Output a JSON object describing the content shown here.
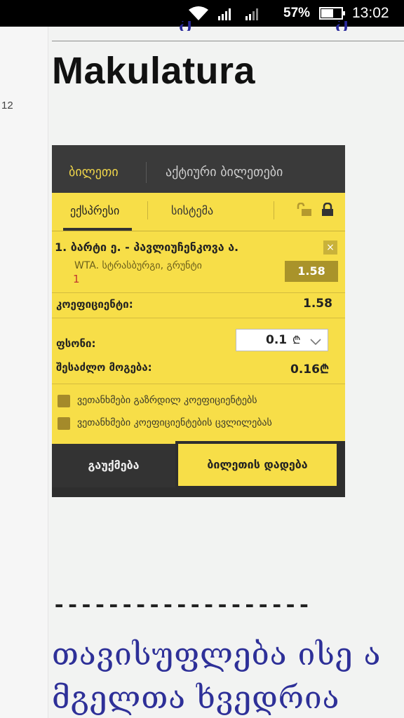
{
  "status_bar": {
    "battery_percent": "57%",
    "time": "13:02",
    "icons": [
      "wifi-icon",
      "cell-signal-icon",
      "cell-signal-weak-icon",
      "battery-icon"
    ]
  },
  "page": {
    "gutter_number": "12",
    "title": "Makulatura",
    "divider": "-------------------",
    "quote_line1": "თავისუფლება ისე ა",
    "quote_line2": "მგელთა ხვედრია"
  },
  "betslip": {
    "tabs": [
      "ბილეთი",
      "აქტიური ბილეთები"
    ],
    "sub_tabs": [
      "ექსპრესი",
      "სისტემა"
    ],
    "selection": {
      "name": "1. ბარტი ე. - პავლიუჩენკოვა ა.",
      "league": "WTA. სტრასბურგი, გრუნტი",
      "outcome": "1",
      "odd": "1.58",
      "remove": "×"
    },
    "coefficient_label": "კოეფიციენტი:",
    "coefficient_value": "1.58",
    "stake_label": "ფსონი:",
    "stake_value": "0.1",
    "currency": "₾",
    "possible_win_label": "შესაძლო მოგება:",
    "possible_win_value": "0.16₾",
    "checkboxes": [
      "ვეთანხმები გაზრდილ კოეფიციენტებს",
      "ვეთანხმები კოეფიციენტების ცვლილებას"
    ],
    "cancel_label": "გაუქმება",
    "place_label": "ბილეთის დადება"
  },
  "colors": {
    "accent_yellow": "#f7de48",
    "dark": "#333333",
    "link_blue": "#2e3098"
  }
}
